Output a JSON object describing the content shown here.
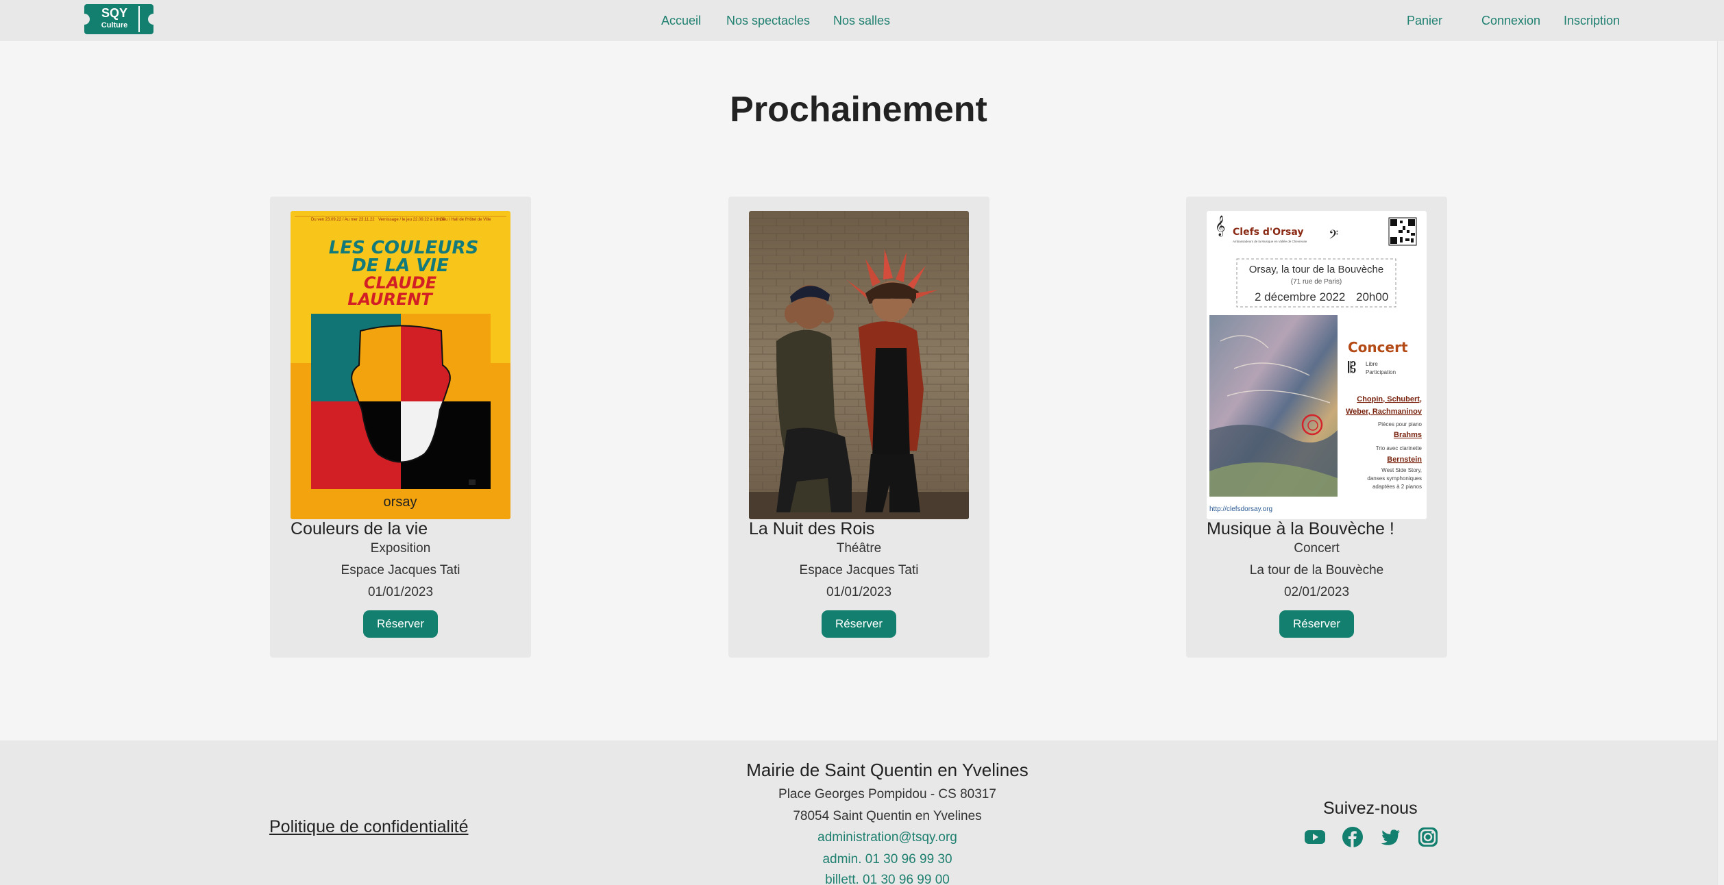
{
  "header": {
    "logo_text_line1": "SQY",
    "logo_text_line2": "Culture",
    "nav": {
      "home": "Accueil",
      "shows": "Nos spectacles",
      "venues": "Nos salles"
    },
    "cart": "Panier",
    "login": "Connexion",
    "signup": "Inscription"
  },
  "page": {
    "title": "Prochainement"
  },
  "events": [
    {
      "title": "Couleurs de la vie",
      "type": "Exposition",
      "venue": "Espace Jacques Tati",
      "date": "01/01/2023",
      "button": "Réserver",
      "poster": {
        "header_col1": "Du ven 23.09.22 / Au mer 23.11.22",
        "header_col2": "Vernissage / le jeu 22.09.22 à 18h30",
        "header_col3": "Lieu / Hall de l'Hôtel de Ville",
        "headline1": "LES COULEURS",
        "headline2": "DE LA VIE",
        "headline3": "CLAUDE",
        "headline4": "LAURENT",
        "brand": "orsay"
      }
    },
    {
      "title": "La Nuit des Rois",
      "type": "Théâtre",
      "venue": "Espace Jacques Tati",
      "date": "01/01/2023",
      "button": "Réserver"
    },
    {
      "title": "Musique à la Bouvèche !",
      "type": "Concert",
      "venue": "La tour de la Bouvèche",
      "date": "02/01/2023",
      "button": "Réserver",
      "poster": {
        "org": "Clefs d'Orsay",
        "org_sub": "Ambassadeurs de la Musique en Vallée de Chevreuse",
        "place": "Orsay, la tour de la Bouvèche",
        "address": "(71 rue de Paris)",
        "date": "2 décembre 2022",
        "time": "20h00",
        "concert": "Concert",
        "entry1": "Libre",
        "entry2": "Participation",
        "composers1": "Chopin, Schubert,",
        "composers2": "Weber, Rachmaninov",
        "piano": "Pièces pour piano",
        "brahms": "Brahms",
        "trio": "Trio avec clarinette",
        "bernstein": "Bernstein",
        "wss1": "West Side Story,",
        "wss2": "danses symphoniques",
        "wss3": "adaptées à 2 pianos",
        "url": "http://clefsdorsay.org"
      }
    }
  ],
  "footer": {
    "privacy": "Politique de confidentialité",
    "org_name": "Mairie de Saint Quentin en Yvelines",
    "address_line1": "Place Georges Pompidou - CS 80317",
    "address_line2": "78054 Saint Quentin en Yvelines",
    "email": "administration@tsqy.org",
    "phone_admin": "admin. 01 30 96 99 30",
    "phone_ticket": "billett. 01 30 96 99 00",
    "follow": "Suivez-nous",
    "socials": [
      "youtube-icon",
      "facebook-icon",
      "twitter-icon",
      "instagram-icon"
    ]
  },
  "colors": {
    "accent": "#137f6e",
    "link": "#1f8070",
    "nav_bg": "#e8e8e8",
    "page_bg": "#f5f5f5"
  }
}
